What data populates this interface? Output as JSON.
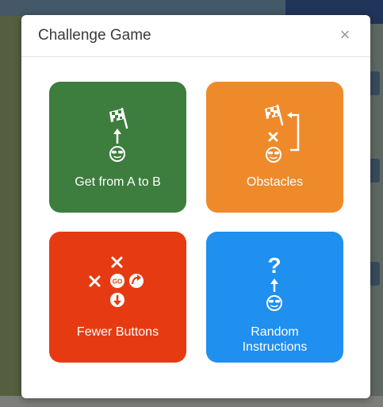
{
  "dialog": {
    "title": "Challenge Game",
    "close_symbol": "×"
  },
  "tiles": [
    {
      "label": "Get from A to B",
      "color": "#3d7e3e",
      "icon": "flag-arrow-face-icon"
    },
    {
      "label": "Obstacles",
      "color": "#ef8a2b",
      "icon": "flag-obstacle-face-icon"
    },
    {
      "label": "Fewer Buttons",
      "color": "#e63b12",
      "icon": "buttons-cross-icon"
    },
    {
      "label": "Random Instructions",
      "color": "#1f8ff0",
      "icon": "question-face-icon"
    }
  ]
}
